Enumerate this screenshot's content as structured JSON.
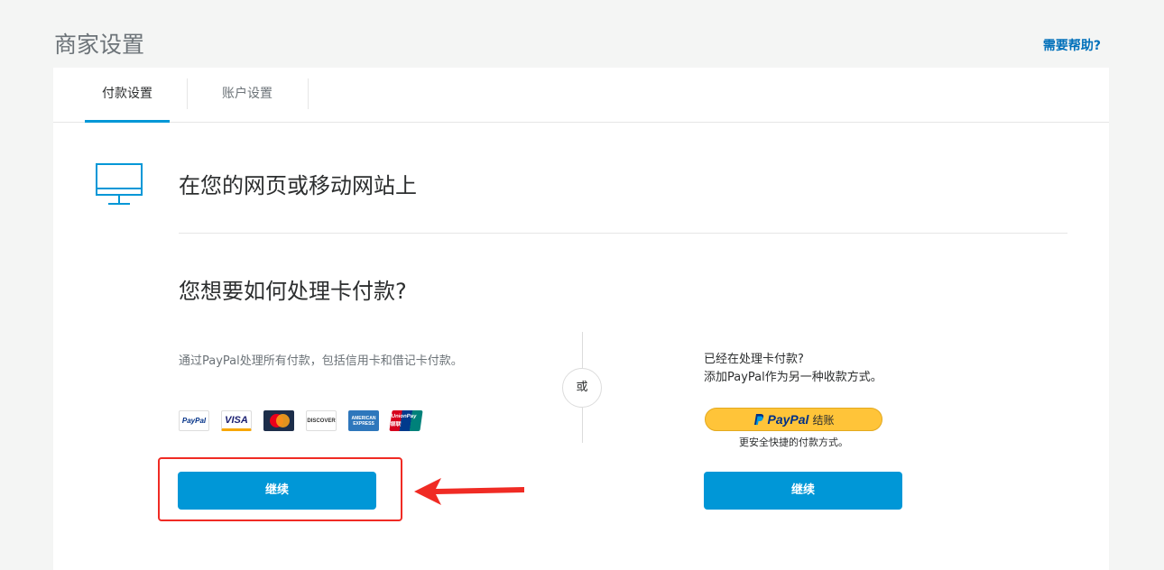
{
  "header": {
    "title": "商家设置",
    "help_link": "需要帮助?"
  },
  "tabs": [
    {
      "label": "付款设置",
      "active": true
    },
    {
      "label": "账户设置",
      "active": false
    }
  ],
  "section": {
    "icon": "monitor-icon",
    "title": "在您的网页或移动网站上"
  },
  "question": "您想要如何处理卡付款?",
  "left_option": {
    "description": "通过PayPal处理所有付款，包括信用卡和借记卡付款。",
    "card_logos": [
      "PayPal",
      "VISA",
      "MasterCard",
      "DISCOVER",
      "AMERICAN EXPRESS",
      "UnionPay 银联"
    ],
    "button_label": "继续"
  },
  "divider": {
    "label": "或"
  },
  "right_option": {
    "description_line1": "已经在处理卡付款?",
    "description_line2": "添加PayPal作为另一种收款方式。",
    "paypal_button": {
      "brand": "PayPal",
      "label": "结账"
    },
    "tagline": "更安全快捷的付款方式。",
    "button_label": "继续"
  },
  "colors": {
    "accent": "#0097d7",
    "link": "#0070ba",
    "annotation": "#f02b24",
    "paypal_yellow": "#ffc439"
  }
}
